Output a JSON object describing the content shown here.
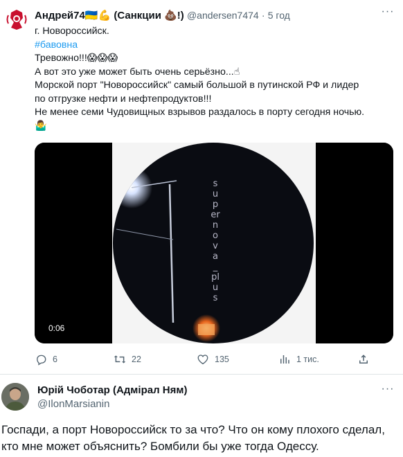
{
  "tweet": {
    "author_name": "Андрей74",
    "author_flag_emoji": "🇺🇦💪",
    "author_sanctions": "(Санкции 💩!)",
    "handle": "@andersen7474",
    "separator": "·",
    "time": "5 год",
    "more_icon": "···",
    "lines": [
      "г. Новороссийск.",
      "#бавовна",
      "Тревожно!!!😱😱😱",
      "А вот это уже может быть очень серьёзно...☝",
      "Морской порт \"Новороссийск\" самый большой в путинской РФ и лидер",
      "по отгрузке нефти и нефтепродуктов!!!",
      "Не менее семи Чудовищных взрывов раздалось в порту сегодня ночью.",
      "🤷‍♂️"
    ],
    "video": {
      "timestamp": "0:06",
      "watermark": "supernova_plus"
    },
    "actions": {
      "replies": "6",
      "retweets": "22",
      "likes": "135",
      "views": "1 тис."
    }
  },
  "reply": {
    "author_name": "Юрій Чоботар (Адмірал Ням)",
    "handle": "@IlonMarsianin",
    "more_icon": "···",
    "lines": [
      "Госпади, а порт Новороссийск то за что? Что он кому плохого сделал,",
      "кто мне может объяснить? Бомбили бы уже тогда Одессу."
    ]
  },
  "colors": {
    "accent": "#1d9bf0",
    "muted": "#536471",
    "text": "#0f1419",
    "divider": "#dfe3e6"
  }
}
